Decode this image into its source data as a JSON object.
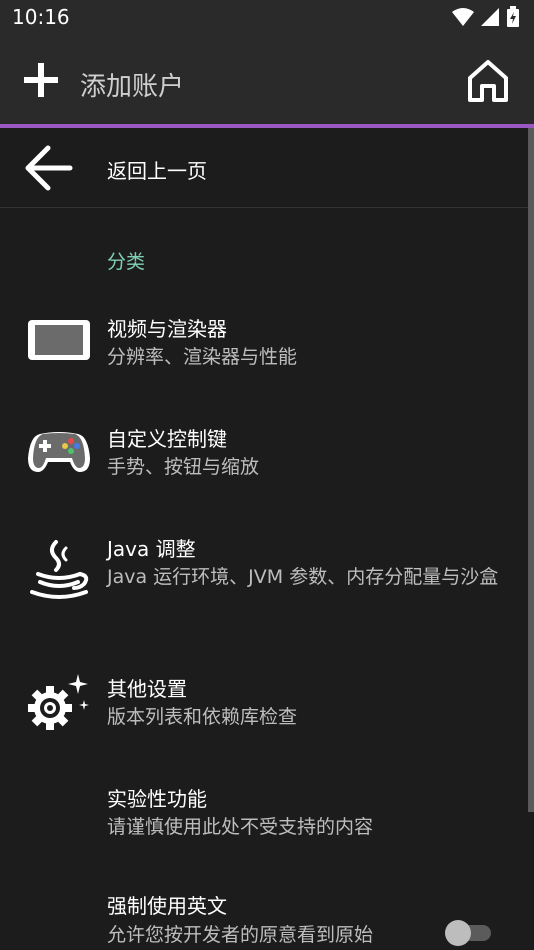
{
  "status_bar": {
    "time": "10:16"
  },
  "app_bar": {
    "title": "添加账户"
  },
  "back": {
    "label": "返回上一页"
  },
  "category": {
    "label": "分类"
  },
  "items": [
    {
      "title": "视频与渲染器",
      "subtitle": "分辨率、渲染器与性能",
      "icon": "display-icon"
    },
    {
      "title": "自定义控制键",
      "subtitle": "手势、按钮与缩放",
      "icon": "gamepad-icon"
    },
    {
      "title": "Java 调整",
      "subtitle": "Java 运行环境、JVM 参数、内存分配量与沙盒",
      "icon": "java-icon"
    },
    {
      "title": "其他设置",
      "subtitle": "版本列表和依赖库检查",
      "icon": "gear-sparkle-icon"
    },
    {
      "title": "实验性功能",
      "subtitle": "请谨慎使用此处不受支持的内容",
      "icon": ""
    },
    {
      "title": "强制使用英文",
      "subtitle": "允许您按开发者的原意看到原始",
      "icon": ""
    }
  ],
  "colors": {
    "accent_line": "#9b57c4",
    "category_text": "#7fcfb6",
    "background": "#1c1c1c",
    "bar_background": "#2a2a2a"
  },
  "toggle": {
    "checked": false
  }
}
